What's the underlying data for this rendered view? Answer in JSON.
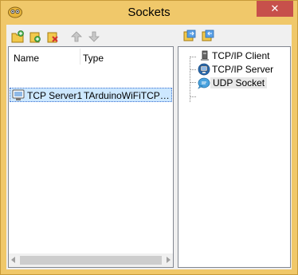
{
  "window": {
    "title": "Sockets",
    "close_label": "✕"
  },
  "toolbar": {
    "left_icons": [
      "add-folder-icon",
      "add-item-icon",
      "delete-icon",
      "move-up-icon",
      "move-down-icon"
    ],
    "right_icons": [
      "connect-icon",
      "disconnect-icon"
    ]
  },
  "list": {
    "columns": [
      "Name",
      "Type"
    ],
    "rows": [
      {
        "name": "TCP Server1",
        "type": "TArduinoWiFiTCPServ..."
      }
    ]
  },
  "tree": {
    "items": [
      {
        "label": "TCP/IP Client",
        "icon": "tcp-client-icon"
      },
      {
        "label": "TCP/IP Server",
        "icon": "tcp-server-icon"
      },
      {
        "label": "UDP Socket",
        "icon": "udp-socket-icon"
      }
    ]
  },
  "colors": {
    "frame": "#f0c86a",
    "close": "#c7504b",
    "selection": "#cde8ff"
  }
}
